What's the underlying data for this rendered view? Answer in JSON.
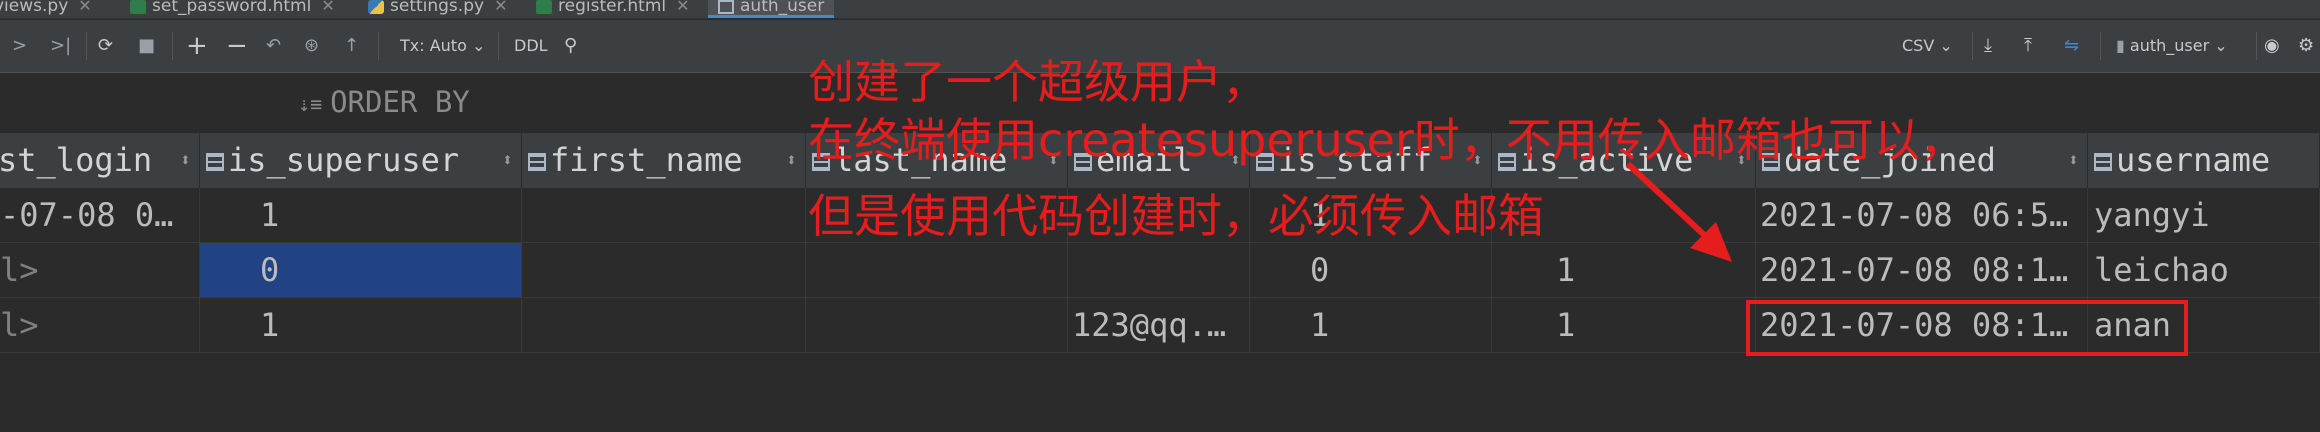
{
  "tabs": [
    {
      "label": "views.py",
      "icon": "python-file-icon"
    },
    {
      "label": "set_password.html",
      "icon": "html-file-icon"
    },
    {
      "label": "settings.py",
      "icon": "python-file-icon"
    },
    {
      "label": "register.html",
      "icon": "html-file-icon"
    },
    {
      "label": "auth_user",
      "icon": "table-icon",
      "active": true
    }
  ],
  "toolbar": {
    "tx_mode": "Tx: Auto",
    "ddl": "DDL",
    "export_format": "CSV",
    "datasource": "auth_user"
  },
  "orderby_label": "ORDER BY",
  "columns": [
    "st_login",
    "is_superuser",
    "first_name",
    "last_name",
    "email",
    "is_staff",
    "is_active",
    "date_joined",
    "username"
  ],
  "rows": [
    {
      "last_login": "-07-08 0…",
      "is_superuser": "1",
      "first_name": "",
      "last_name": "",
      "email": "",
      "is_staff": "1",
      "is_active": "",
      "date_joined": "2021-07-08 06:5…",
      "username": "yangyi"
    },
    {
      "last_login": "l>",
      "is_superuser": "0",
      "first_name": "",
      "last_name": "",
      "email": "",
      "is_staff": "0",
      "is_active": "1",
      "date_joined": "2021-07-08 08:1…",
      "username": "leichao"
    },
    {
      "last_login": "l>",
      "is_superuser": "1",
      "first_name": "",
      "last_name": "",
      "email": "123@qq.…",
      "is_staff": "1",
      "is_active": "1",
      "date_joined": "2021-07-08 08:1…",
      "username": "anan"
    }
  ],
  "annotation": {
    "line1": "创建了一个超级用户，",
    "line2": "在终端使用createsuperuser时，不用传入邮箱也可以，",
    "line3": "但是使用代码创建时，必须传入邮箱",
    "color": "#e51d1d"
  },
  "colors": {
    "background": "#2b2b2b",
    "header": "#3c3f41",
    "selection": "#214283",
    "active_tab_underline": "#4a88c7"
  }
}
